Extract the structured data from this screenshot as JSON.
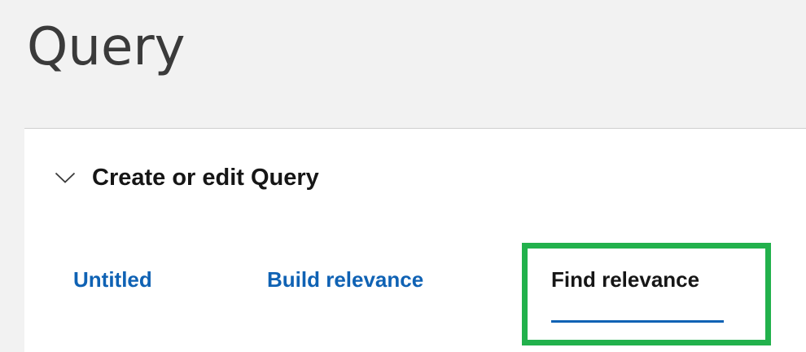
{
  "page": {
    "title": "Query"
  },
  "section": {
    "title": "Create or edit Query",
    "expanded": true,
    "chevron_icon": "chevron-down-icon"
  },
  "tabs": [
    {
      "label": "Untitled",
      "active": false
    },
    {
      "label": "Build relevance",
      "active": false
    },
    {
      "label": "Find relevance",
      "active": true
    }
  ],
  "colors": {
    "background": "#f2f2f2",
    "panel": "#ffffff",
    "tab_link": "#0f62b4",
    "tab_active_text": "#161616",
    "tab_underline": "#0f62b4",
    "highlight": "#22b14c"
  }
}
